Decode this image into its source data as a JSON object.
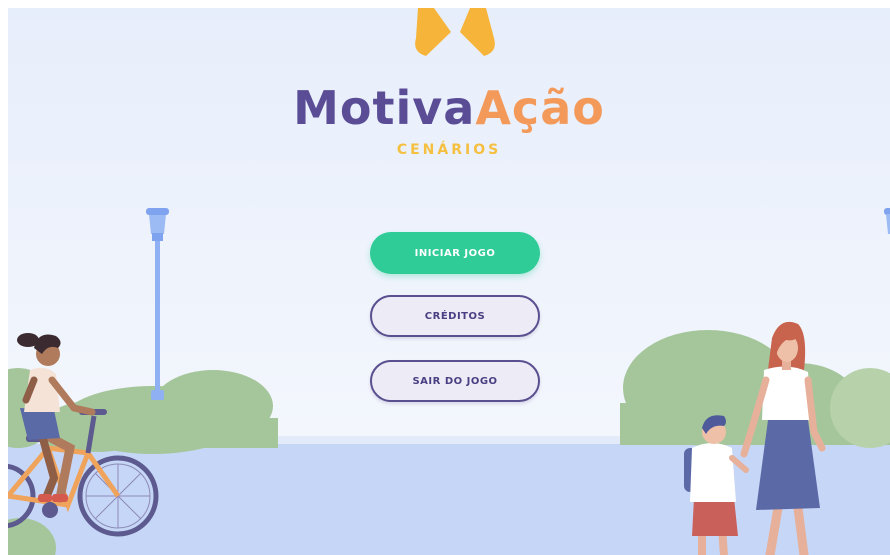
{
  "logo": {
    "part1": "Motiva",
    "part2": "Ação"
  },
  "subtitle": "CENÁRIOS",
  "menu": {
    "start_label": "INICIAR JOGO",
    "credits_label": "CRÉDITOS",
    "exit_label": "SAIR DO JOGO"
  },
  "colors": {
    "logo_primary": "#5a4d96",
    "logo_accent": "#f39a5b",
    "subtitle": "#f5bf3f",
    "primary_button": "#2fcc97",
    "outline_border": "#5a4f8f",
    "ground": "#c6d6f6",
    "bushes": "#a5c69a"
  },
  "icons": [
    "logo-mark-icon",
    "street-lamp",
    "bush",
    "cyclist",
    "mother",
    "child"
  ]
}
